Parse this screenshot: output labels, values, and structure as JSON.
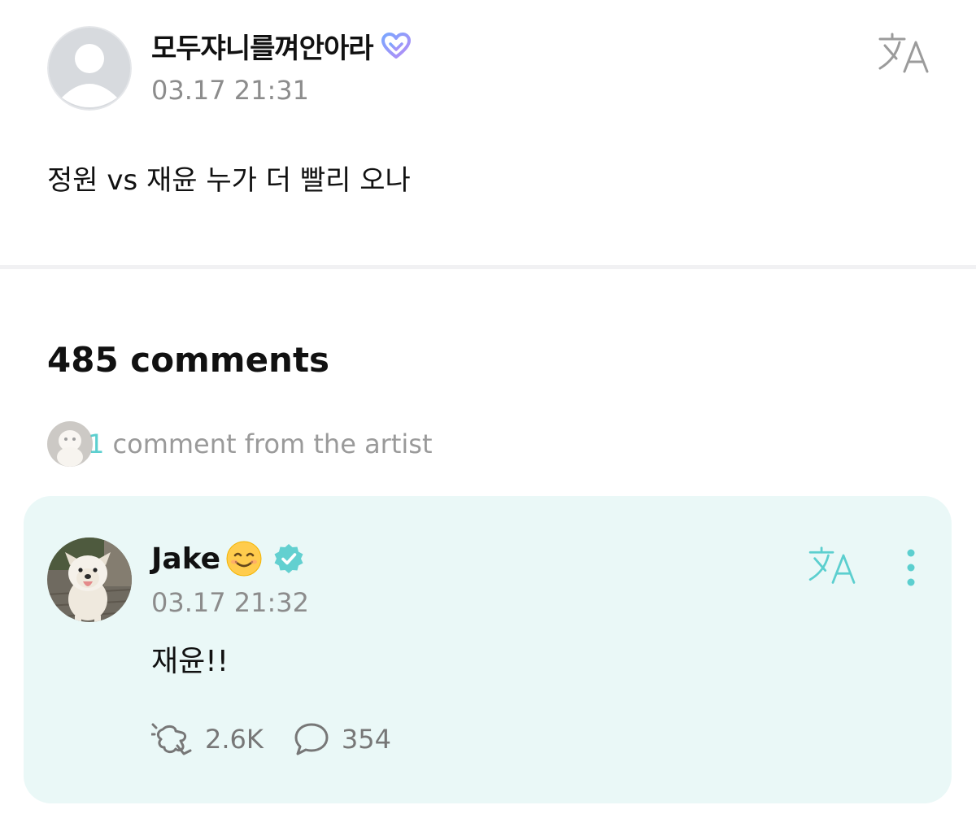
{
  "post": {
    "author": {
      "name": "모두쟈니를껴안아라",
      "badge_icon": "heart-membership-icon",
      "avatar_icon": "default-avatar-icon"
    },
    "timestamp": "03.17 21:31",
    "translate_icon": "translate-icon",
    "body": "정원 vs 재윤 누가 더 빨리 오나"
  },
  "comments": {
    "count_label": "485 comments",
    "artist_summary": {
      "count": "1",
      "label": " comment from the artist"
    },
    "items": [
      {
        "author": {
          "name": "Jake",
          "emoji": "😊",
          "verified_icon": "verified-badge-icon",
          "avatar_icon": "dog-photo-avatar"
        },
        "timestamp": "03.17 21:32",
        "body": "재윤!!",
        "likes": "2.6K",
        "replies": "354"
      }
    ]
  },
  "colors": {
    "accent": "#5ccfcf",
    "card_background": "#eaf8f7",
    "muted_text": "#8c8c8c",
    "divider": "#f1f1f3"
  }
}
